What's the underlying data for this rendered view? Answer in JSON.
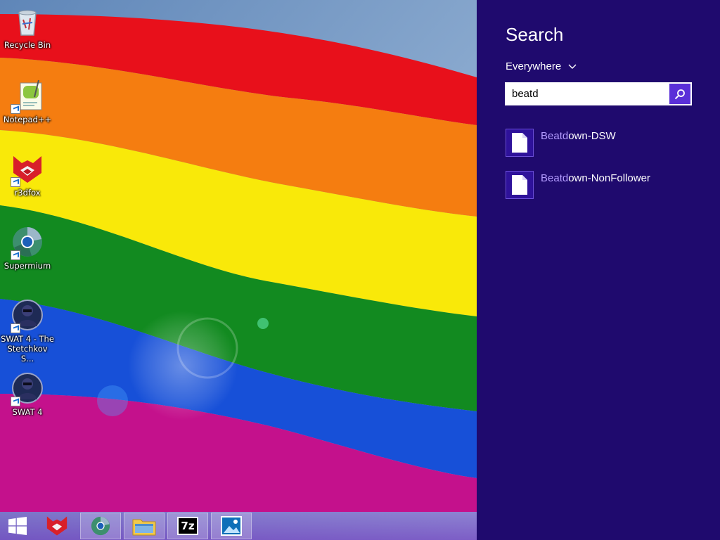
{
  "desktop": {
    "icons": [
      {
        "label": "Recycle Bin",
        "icon": "recycle-bin-icon"
      },
      {
        "label": "Notepad++",
        "icon": "notepad-plus-plus-icon"
      },
      {
        "label": "r3dfox",
        "icon": "r3dfox-icon"
      },
      {
        "label": "Supermium",
        "icon": "supermium-icon"
      },
      {
        "label": "SWAT 4 - The Stetchkov S...",
        "icon": "swat4-icon"
      },
      {
        "label": "SWAT 4",
        "icon": "swat4-icon"
      }
    ]
  },
  "taskbar": {
    "items": [
      {
        "name": "start-button",
        "icon": "windows-logo-icon"
      },
      {
        "name": "r3dfox",
        "icon": "r3dfox-icon"
      },
      {
        "name": "supermium",
        "icon": "supermium-icon"
      },
      {
        "name": "file-explorer",
        "icon": "folder-icon"
      },
      {
        "name": "7-zip",
        "icon": "seven-zip-icon",
        "text": "7z"
      },
      {
        "name": "photos",
        "icon": "photos-icon"
      }
    ]
  },
  "search": {
    "title": "Search",
    "scope": "Everywhere",
    "query": "beatd",
    "results": [
      {
        "match": "Beatd",
        "rest": "own-DSW",
        "icon": "file-icon"
      },
      {
        "match": "Beatd",
        "rest": "own-NonFollower",
        "icon": "file-icon"
      }
    ]
  },
  "colors": {
    "charm_background": "#1f0a6e",
    "search_button": "#5a2fd8",
    "match_highlight": "#b49cff"
  }
}
